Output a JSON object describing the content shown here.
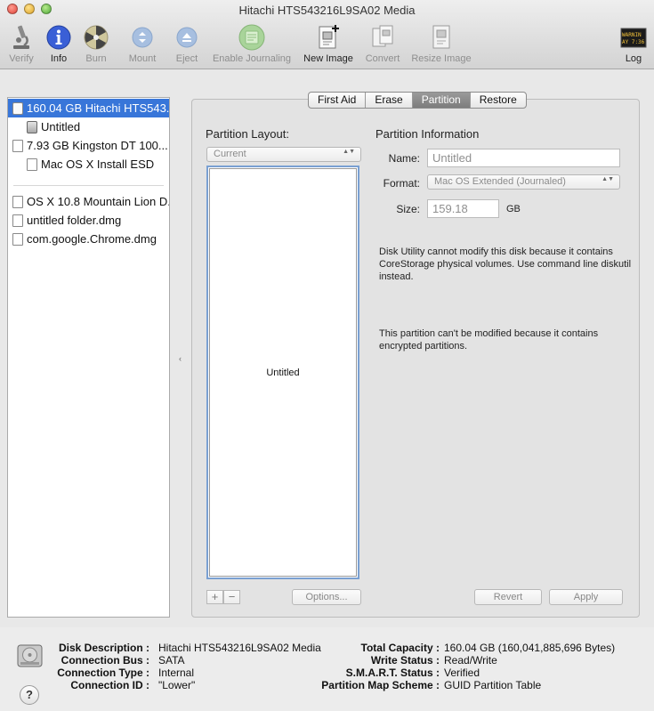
{
  "window": {
    "title": "Hitachi HTS543216L9SA02 Media"
  },
  "toolbar": {
    "items": [
      {
        "label": "Verify",
        "icon": "microscope-icon",
        "enabled": false
      },
      {
        "label": "Info",
        "icon": "info-icon",
        "enabled": true
      },
      {
        "label": "Burn",
        "icon": "burn-icon",
        "enabled": false
      },
      {
        "label": "Mount",
        "icon": "mount-icon",
        "enabled": false
      },
      {
        "label": "Eject",
        "icon": "eject-icon",
        "enabled": false
      },
      {
        "label": "Enable Journaling",
        "icon": "journaling-icon",
        "enabled": false
      },
      {
        "label": "New Image",
        "icon": "new-image-icon",
        "enabled": true
      },
      {
        "label": "Convert",
        "icon": "convert-icon",
        "enabled": false
      },
      {
        "label": "Resize Image",
        "icon": "resize-image-icon",
        "enabled": false
      },
      {
        "label": "Log",
        "icon": "console-log-icon",
        "enabled": true,
        "log_icon_text": "WARNIN AY 7:36"
      }
    ]
  },
  "sidebar": {
    "items": [
      {
        "label": "160.04 GB Hitachi HTS543...",
        "selected": true
      },
      {
        "label": "Untitled"
      },
      {
        "label": "7.93 GB Kingston DT 100..."
      },
      {
        "label": "Mac OS X Install ESD"
      },
      {
        "label": "OS X 10.8 Mountain Lion D..."
      },
      {
        "label": "untitled folder.dmg"
      },
      {
        "label": "com.google.Chrome.dmg"
      }
    ]
  },
  "tabs": [
    {
      "label": "First Aid"
    },
    {
      "label": "Erase"
    },
    {
      "label": "Partition",
      "active": true
    },
    {
      "label": "Restore"
    }
  ],
  "partition": {
    "layout_label": "Partition Layout:",
    "layout_value": "Current",
    "layout_partition": "Untitled",
    "info_label": "Partition Information",
    "name_label": "Name:",
    "name_value": "Untitled",
    "format_label": "Format:",
    "format_value": "Mac OS Extended (Journaled)",
    "size_label": "Size:",
    "size_value": "159.18",
    "size_unit": "GB",
    "message1": "Disk Utility cannot modify this disk because it contains CoreStorage physical volumes. Use command line diskutil instead.",
    "message2": "This partition can't be modified because it contains encrypted partitions.",
    "add_label": "+",
    "remove_label": "−",
    "options_label": "Options...",
    "revert_label": "Revert",
    "apply_label": "Apply"
  },
  "details": {
    "left": [
      {
        "key": "Disk Description :",
        "value": "Hitachi HTS543216L9SA02 Media"
      },
      {
        "key": "Connection Bus :",
        "value": "SATA"
      },
      {
        "key": "Connection Type :",
        "value": "Internal"
      },
      {
        "key": "Connection ID :",
        "value": "\"Lower\""
      }
    ],
    "right": [
      {
        "key": "Total Capacity :",
        "value": "160.04 GB (160,041,885,696 Bytes)"
      },
      {
        "key": "Write Status :",
        "value": "Read/Write"
      },
      {
        "key": "S.M.A.R.T. Status :",
        "value": "Verified"
      },
      {
        "key": "Partition Map Scheme :",
        "value": "GUID Partition Table"
      }
    ],
    "help_label": "?"
  },
  "colors": {
    "selection": "#3876d9",
    "layout_border": "#7aa0d2"
  }
}
